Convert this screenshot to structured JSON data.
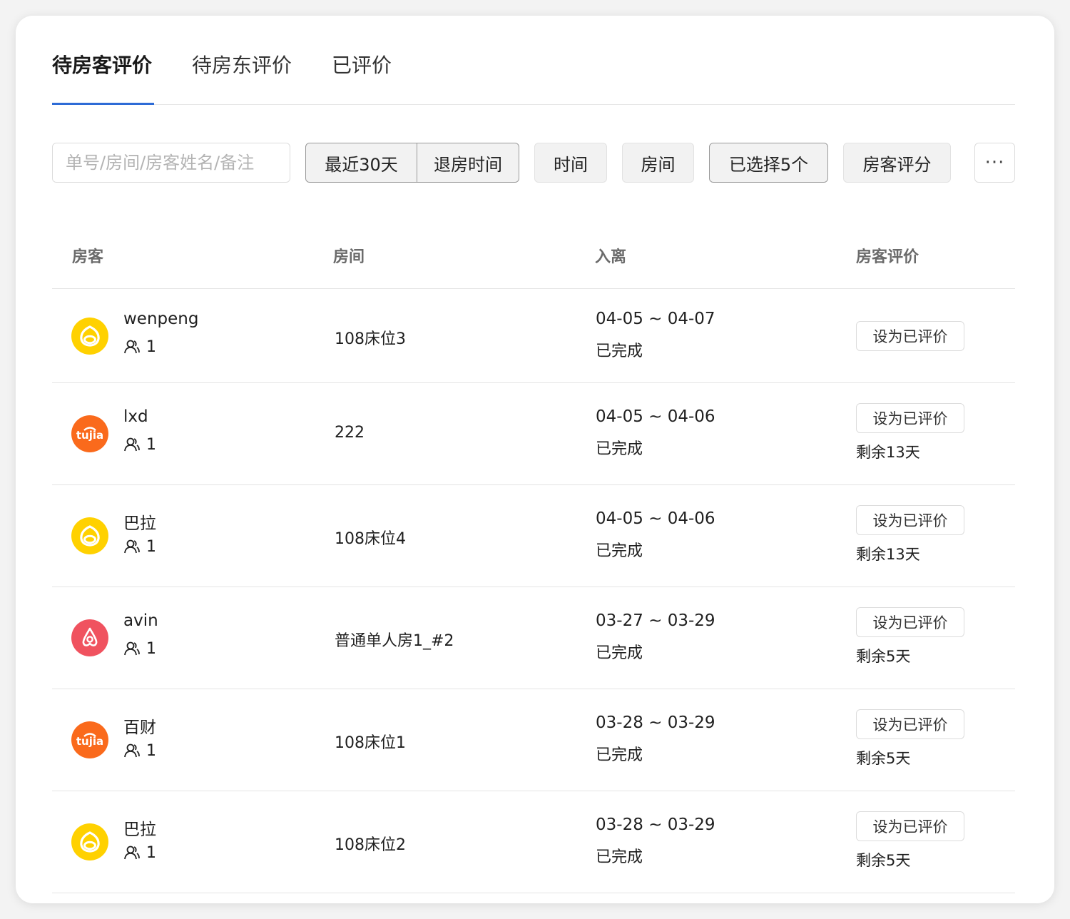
{
  "tabs": [
    {
      "label": "待房客评价",
      "active": true
    },
    {
      "label": "待房东评价",
      "active": false
    },
    {
      "label": "已评价",
      "active": false
    }
  ],
  "filters": {
    "search_placeholder": "单号/房间/房客姓名/备注",
    "range_label": "最近30天",
    "range_type_label": "退房时间",
    "time_label": "时间",
    "room_label": "房间",
    "selected_label": "已选择5个",
    "score_label": "房客评分",
    "more_label": "···"
  },
  "table": {
    "headers": [
      "房客",
      "房间",
      "入离",
      "房客评价"
    ],
    "action_label": "设为已评价",
    "rows": [
      {
        "channel": "meituan",
        "name": "wenpeng",
        "guests": "1",
        "room": "108床位3",
        "dates": "04-05 ~ 04-07",
        "status": "已完成",
        "remaining": ""
      },
      {
        "channel": "tujia",
        "name": "lxd",
        "guests": "1",
        "room": "222",
        "dates": "04-05 ~ 04-06",
        "status": "已完成",
        "remaining": "剩余13天"
      },
      {
        "channel": "meituan",
        "name": "巴拉",
        "guests": "1",
        "room": "108床位4",
        "dates": "04-05 ~ 04-06",
        "status": "已完成",
        "remaining": "剩余13天"
      },
      {
        "channel": "airbnb",
        "name": "avin",
        "guests": "1",
        "room": "普通单人房1_#2",
        "dates": "03-27 ~ 03-29",
        "status": "已完成",
        "remaining": "剩余5天"
      },
      {
        "channel": "tujia",
        "name": "百财",
        "guests": "1",
        "room": "108床位1",
        "dates": "03-28 ~ 03-29",
        "status": "已完成",
        "remaining": "剩余5天"
      },
      {
        "channel": "meituan",
        "name": "巴拉",
        "guests": "1",
        "room": "108床位2",
        "dates": "03-28 ~ 03-29",
        "status": "已完成",
        "remaining": "剩余5天"
      }
    ]
  },
  "logos": {
    "tujia_text": "tujia"
  },
  "colors": {
    "accent": "#2d6bd6",
    "meituan": "#ffd100",
    "tujia": "#fa6a1c",
    "airbnb": "#f0525f"
  },
  "icons": {
    "guest": "user-group-icon"
  }
}
